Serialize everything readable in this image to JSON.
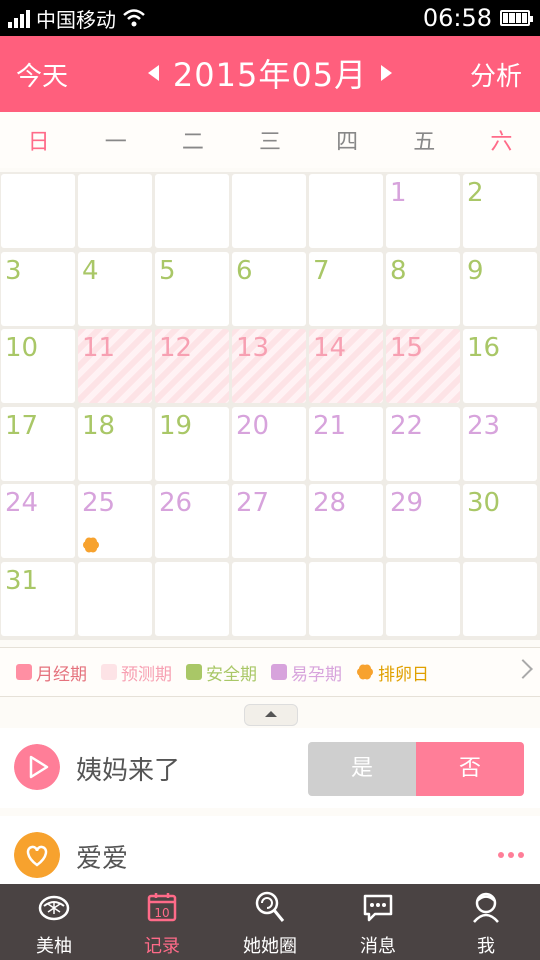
{
  "status_bar": {
    "carrier": "中国移动",
    "time": "06:58"
  },
  "header": {
    "today_label": "今天",
    "month_title": "2015年05月",
    "analysis_label": "分析"
  },
  "weekdays": [
    "日",
    "一",
    "二",
    "三",
    "四",
    "五",
    "六"
  ],
  "calendar": {
    "colors": {
      "safe": "#a9c767",
      "fertile": "#d7a3dc",
      "predicted": "#fde3e6",
      "period": "#ff8fa3",
      "ovulation": "#f7a22e"
    },
    "first_weekday": 5,
    "rows": 6,
    "days": [
      {
        "d": "1",
        "type": "fertile"
      },
      {
        "d": "2",
        "type": "safe"
      },
      {
        "d": "3",
        "type": "safe"
      },
      {
        "d": "4",
        "type": "safe"
      },
      {
        "d": "5",
        "type": "safe"
      },
      {
        "d": "6",
        "type": "safe"
      },
      {
        "d": "7",
        "type": "safe"
      },
      {
        "d": "8",
        "type": "safe"
      },
      {
        "d": "9",
        "type": "safe"
      },
      {
        "d": "10",
        "type": "safe"
      },
      {
        "d": "11",
        "type": "predicted"
      },
      {
        "d": "12",
        "type": "predicted"
      },
      {
        "d": "13",
        "type": "predicted"
      },
      {
        "d": "14",
        "type": "predicted"
      },
      {
        "d": "15",
        "type": "predicted"
      },
      {
        "d": "16",
        "type": "safe"
      },
      {
        "d": "17",
        "type": "safe"
      },
      {
        "d": "18",
        "type": "safe"
      },
      {
        "d": "19",
        "type": "safe"
      },
      {
        "d": "20",
        "type": "fertile"
      },
      {
        "d": "21",
        "type": "fertile"
      },
      {
        "d": "22",
        "type": "fertile"
      },
      {
        "d": "23",
        "type": "fertile"
      },
      {
        "d": "24",
        "type": "fertile"
      },
      {
        "d": "25",
        "type": "fertile",
        "ovulation": true
      },
      {
        "d": "26",
        "type": "fertile"
      },
      {
        "d": "27",
        "type": "fertile"
      },
      {
        "d": "28",
        "type": "fertile"
      },
      {
        "d": "29",
        "type": "fertile"
      },
      {
        "d": "30",
        "type": "safe"
      },
      {
        "d": "31",
        "type": "safe"
      }
    ]
  },
  "legend": [
    {
      "label": "月经期",
      "color": "#ff8fa3",
      "text_color": "#e5727d"
    },
    {
      "label": "预测期",
      "color": "#fde3e6",
      "text_color": "#f7a0b2"
    },
    {
      "label": "安全期",
      "color": "#a9c767",
      "text_color": "#a9c767"
    },
    {
      "label": "易孕期",
      "color": "#d7a3dc",
      "text_color": "#d7a3dc"
    },
    {
      "label": "排卵日",
      "color": "#f7a22e",
      "text_color": "#e0a000"
    }
  ],
  "period_row": {
    "label": "姨妈来了",
    "yes_label": "是",
    "no_label": "否"
  },
  "love_row": {
    "label": "爱爱"
  },
  "tabbar": [
    {
      "label": "美柚",
      "icon": "lemon-icon",
      "active": false
    },
    {
      "label": "记录",
      "icon": "calendar-icon",
      "active": true,
      "badge": "10"
    },
    {
      "label": "她她圈",
      "icon": "lollipop-icon",
      "active": false
    },
    {
      "label": "消息",
      "icon": "chat-bubble-icon",
      "active": false
    },
    {
      "label": "我",
      "icon": "profile-icon",
      "active": false
    }
  ]
}
